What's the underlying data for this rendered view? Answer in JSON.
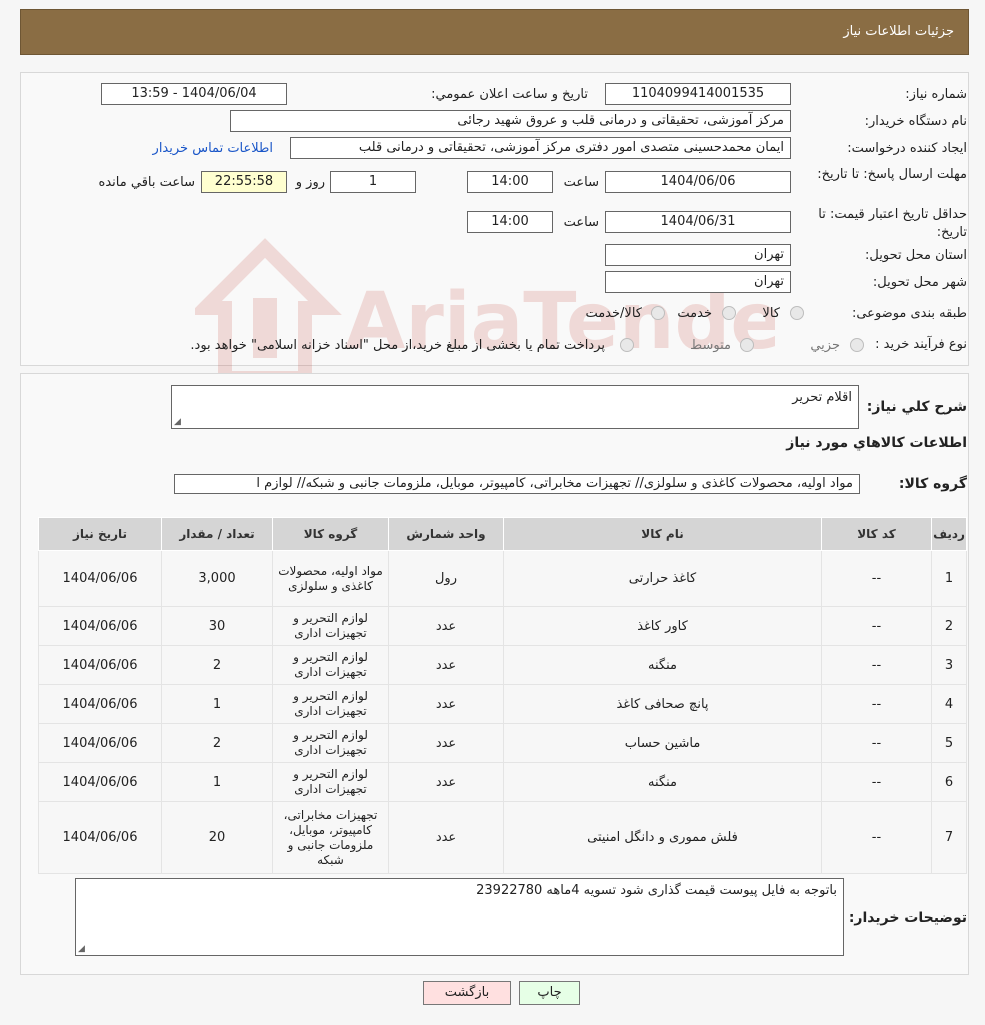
{
  "header": {
    "title": "جزئیات اطلاعات نیاز"
  },
  "form": {
    "need_number_label": "شماره نیاز:",
    "need_number": "1104099414001535",
    "announce_label": "تاریخ و ساعت اعلان عمومي:",
    "announce_value": "1404/06/04 - 13:59",
    "buyer_org_label": "نام دستگاه خريدار:",
    "buyer_org": "مرکز آموزشی، تحقیقاتی و درمانی قلب و عروق شهید رجائی",
    "requester_label": "ايجاد کننده درخواست:",
    "requester": "ایمان محمدحسینی متصدی امور دفتری مرکز آموزشی، تحقیقاتی و درمانی قلب",
    "contact_link": "اطلاعات تماس خريدار",
    "deadline_label": "مهلت ارسال پاسخ: تا تاريخ:",
    "deadline_date": "1404/06/06",
    "time_label": "ساعت",
    "deadline_time": "14:00",
    "days_value": "1",
    "days_label": "روز و",
    "remaining_time": "22:55:58",
    "remaining_label": "ساعت باقي مانده",
    "validity_label": "حداقل تاريخ اعتبار قيمت: تا تاريخ:",
    "validity_date": "1404/06/31",
    "validity_time": "14:00",
    "province_label": "استان محل تحويل:",
    "province": "تهران",
    "city_label": "شهر محل تحويل:",
    "city": "تهران",
    "category_label": "طبقه بندی موضوعی:",
    "category_options": [
      "کالا",
      "خدمت",
      "کالا/خدمت"
    ],
    "process_label": "نوع فرآيند خريد :",
    "process_options": [
      "جزیي",
      "متوسط"
    ],
    "process_note": "پرداخت تمام یا بخشی از مبلغ خرید،از محل \"اسناد خزانه اسلامی\" خواهد بود."
  },
  "details": {
    "summary_label": "شرح کلي نياز:",
    "summary_value": "اقلام تحریر",
    "goods_info_title": "اطلاعات کالاهاي مورد نياز",
    "goods_group_label": "گروه کالا:",
    "goods_group_value": "مواد اولیه، محصولات کاغذی و سلولزی// تجهیزات مخابراتی، کامپیوتر، موبایل، ملزومات جانبی و شبکه// لوازم ا"
  },
  "table": {
    "headers": [
      "رديف",
      "کد کالا",
      "نام کالا",
      "واحد شمارش",
      "گروه کالا",
      "تعداد / مقدار",
      "تاريخ نياز"
    ],
    "rows": [
      {
        "row": "1",
        "code": "--",
        "name": "کاغذ حرارتی",
        "unit": "رول",
        "group": "مواد اولیه، محصولات کاغذی و سلولزی",
        "qty": "3,000",
        "date": "1404/06/06"
      },
      {
        "row": "2",
        "code": "--",
        "name": "کاور کاغذ",
        "unit": "عدد",
        "group": "لوازم التحریر و تجهیزات اداری",
        "qty": "30",
        "date": "1404/06/06"
      },
      {
        "row": "3",
        "code": "--",
        "name": "منگنه",
        "unit": "عدد",
        "group": "لوازم التحریر و تجهیزات اداری",
        "qty": "2",
        "date": "1404/06/06"
      },
      {
        "row": "4",
        "code": "--",
        "name": "پانچ صحافی کاغذ",
        "unit": "عدد",
        "group": "لوازم التحریر و تجهیزات اداری",
        "qty": "1",
        "date": "1404/06/06"
      },
      {
        "row": "5",
        "code": "--",
        "name": "ماشین حساب",
        "unit": "عدد",
        "group": "لوازم التحریر و تجهیزات اداری",
        "qty": "2",
        "date": "1404/06/06"
      },
      {
        "row": "6",
        "code": "--",
        "name": "منگنه",
        "unit": "عدد",
        "group": "لوازم التحریر و تجهیزات اداری",
        "qty": "1",
        "date": "1404/06/06"
      },
      {
        "row": "7",
        "code": "--",
        "name": "فلش مموری و دانگل امنیتی",
        "unit": "عدد",
        "group": "تجهیزات مخابراتی، کامپیوتر، موبایل، ملزومات جانبی و شبکه",
        "qty": "20",
        "date": "1404/06/06"
      }
    ]
  },
  "buyer_notes": {
    "label": "توضيحات خريدار:",
    "value": "باتوجه به فایل پیوست قیمت گذاری شود تسویه 4ماهه 23922780"
  },
  "buttons": {
    "print": "چاپ",
    "back": "بازگشت"
  },
  "watermark": {
    "text": "AriaTender.neT"
  },
  "colors": {
    "header_bg": "#8a6d44",
    "link": "#1a56c8",
    "back_btn": "#ffe0e0",
    "print_btn": "#e6ffe6"
  }
}
